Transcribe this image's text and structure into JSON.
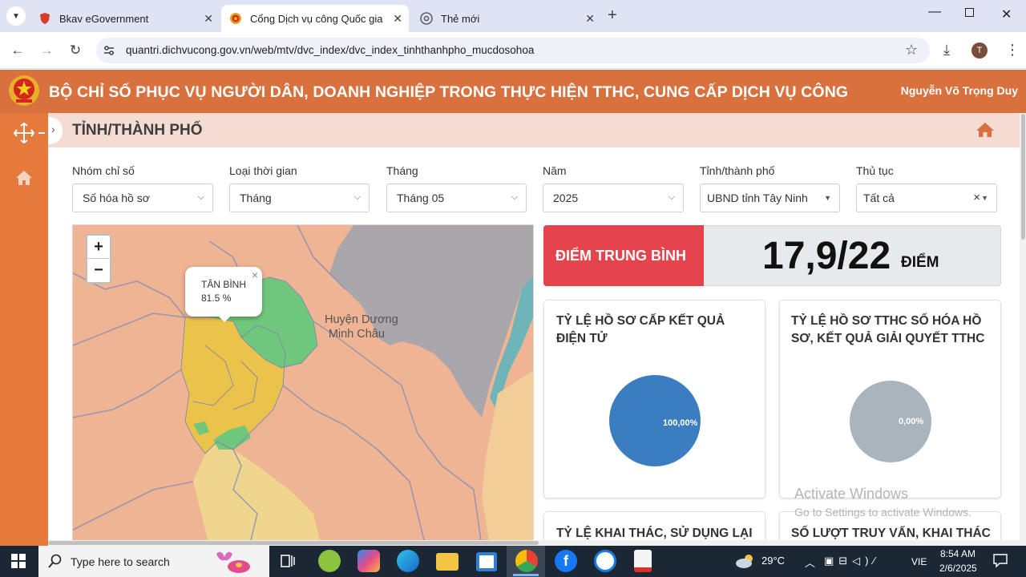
{
  "browser": {
    "tabs": [
      {
        "title": "Bkav eGovernment",
        "active": false
      },
      {
        "title": "Cổng Dịch vụ công Quốc gia",
        "active": true
      },
      {
        "title": "Thẻ mới",
        "active": false
      }
    ],
    "url": "quantri.dichvucong.gov.vn/web/mtv/dvc_index/dvc_index_tinhthanhpho_mucdosohoa",
    "profile_initial": "T"
  },
  "header": {
    "title": "BỘ CHỈ SỐ PHỤC VỤ NGƯỜI DÂN, DOANH NGHIỆP TRONG THỰC HIỆN TTHC, CUNG CẤP DỊCH VỤ CÔNG",
    "user": "Nguyễn Võ Trọng Duy"
  },
  "page": {
    "title": "TỈNH/THÀNH PHỐ"
  },
  "filters": [
    {
      "label": "Nhóm chỉ số",
      "value": "Số hóa hồ sơ"
    },
    {
      "label": "Loại thời gian",
      "value": "Tháng"
    },
    {
      "label": "Tháng",
      "value": "Tháng 05"
    },
    {
      "label": "Năm",
      "value": "2025"
    },
    {
      "label": "Tỉnh/thành phố",
      "value": "UBND tỉnh Tây Ninh"
    },
    {
      "label": "Thủ tục",
      "value": "Tất cả",
      "clear": "×"
    }
  ],
  "map": {
    "zoom_in": "+",
    "zoom_out": "−",
    "place_label_line1": "Huyện Dương",
    "place_label_line2": "Minh Châu",
    "popup": {
      "name": "TÂN BÌNH",
      "value": "81.5 %",
      "close": "×"
    }
  },
  "score": {
    "label": "ĐIỂM TRUNG BÌNH",
    "value": "17,9/22",
    "unit": "ĐIỂM"
  },
  "cards": [
    {
      "title": "TỶ LỆ HỒ SƠ CẤP KẾT QUẢ ĐIỆN TỬ",
      "pie_label": "100,00%",
      "pie_color": "#3b7dc1"
    },
    {
      "title": "TỶ LỆ HỒ SƠ TTHC SỐ HÓA HỒ SƠ, KẾT QUẢ GIẢI QUYẾT TTHC",
      "pie_label": "0,00%",
      "pie_color": "#a9b4bc"
    },
    {
      "title": "TỶ LỆ KHAI THÁC, SỬ DỤNG LẠI"
    },
    {
      "title": "SỐ LƯỢT TRUY VẤN, KHAI THÁC"
    }
  ],
  "watermark": {
    "line1": "Activate Windows",
    "line2": "Go to Settings to activate Windows."
  },
  "taskbar": {
    "search_placeholder": "Type here to search",
    "weather": "29°C",
    "lang": "VIE",
    "time": "8:54 AM",
    "date": "2/6/2025"
  },
  "colors": {
    "header": "#d8713e",
    "sidebar": "#e57a3d",
    "score_label": "#e5444d",
    "map_green": "#6fc77b",
    "map_yellow": "#ebc34b"
  }
}
